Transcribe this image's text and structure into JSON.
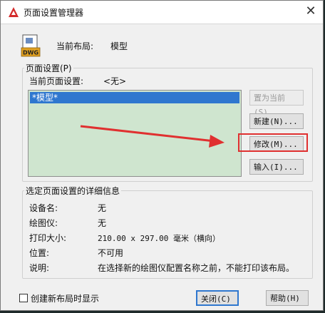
{
  "window": {
    "title": "页面设置管理器",
    "close_glyph": "✕"
  },
  "current_layout": {
    "label": "当前布局:",
    "value": "模型",
    "icon_text": "DWG"
  },
  "page_setups": {
    "group_title": "页面设置(P)",
    "current_label": "当前页面设置:",
    "current_value": "<无>",
    "items": [
      {
        "label": "*模型*",
        "selected": true
      }
    ]
  },
  "buttons": {
    "set_current": "置为当前(S)",
    "new": "新建(N)...",
    "modify": "修改(M)...",
    "import": "输入(I)...",
    "close": "关闭(C)",
    "help": "帮助(H)"
  },
  "details": {
    "group_title": "选定页面设置的详细信息",
    "rows": [
      {
        "label": "设备名:",
        "value": "无"
      },
      {
        "label": "绘图仪:",
        "value": "无"
      },
      {
        "label": "打印大小:",
        "value": "210.00 x 297.00 毫米（横向）"
      },
      {
        "label": "位置:",
        "value": "不可用"
      },
      {
        "label": "说明:",
        "value": "在选择新的绘图仪配置名称之前，不能打印该布局。"
      }
    ]
  },
  "footer": {
    "show_on_new_layout_label": "创建新布局时显示",
    "show_on_new_layout_checked": false
  },
  "colors": {
    "list_background": "#cfe5cf",
    "selection": "#2f77cf",
    "annotation_red": "#e03030"
  }
}
